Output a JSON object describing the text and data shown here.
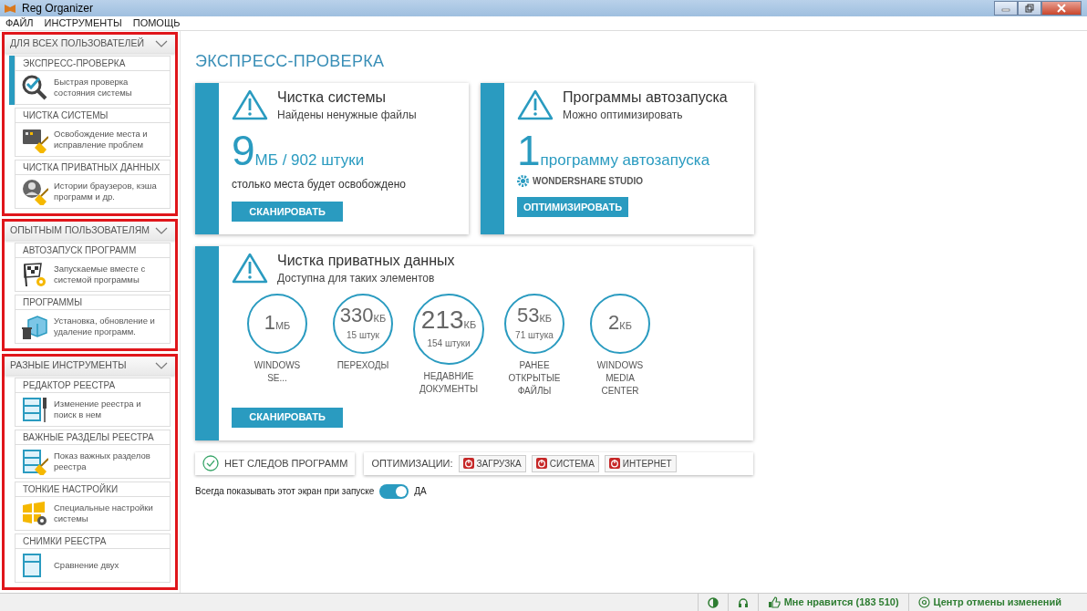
{
  "window": {
    "title": "Reg Organizer"
  },
  "menu": [
    "ФАЙЛ",
    "ИНСТРУМЕНТЫ",
    "ПОМОЩЬ"
  ],
  "sidebar": {
    "groups": [
      {
        "title": "ДЛЯ ВСЕХ ПОЛЬЗОВАТЕЛЕЙ",
        "expanded": true,
        "highlighted": true,
        "items": [
          {
            "title": "ЭКСПРЕСС-ПРОВЕРКА",
            "description": "Быстрая проверка состояния системы",
            "selected": true
          },
          {
            "title": "ЧИСТКА СИСТЕМЫ",
            "description": "Освобождение места и исправление проблем",
            "selected": false
          },
          {
            "title": "ЧИСТКА ПРИВАТНЫХ ДАННЫХ",
            "description": "Истории браузеров, кэша программ и др.",
            "selected": false
          }
        ]
      },
      {
        "title": "ОПЫТНЫМ ПОЛЬЗОВАТЕЛЯМ",
        "expanded": true,
        "highlighted": true,
        "items": [
          {
            "title": "АВТОЗАПУСК ПРОГРАММ",
            "description": "Запускаемые вместе с системой программы",
            "selected": false
          },
          {
            "title": "ПРОГРАММЫ",
            "description": "Установка, обновление и удаление программ.",
            "selected": false
          }
        ]
      },
      {
        "title": "РАЗНЫЕ ИНСТРУМЕНТЫ",
        "expanded": true,
        "highlighted": true,
        "items": [
          {
            "title": "РЕДАКТОР РЕЕСТРА",
            "description": "Изменение реестра и поиск в нем",
            "selected": false
          },
          {
            "title": "ВАЖНЫЕ РАЗДЕЛЫ РЕЕСТРА",
            "description": "Показ важных разделов реестра",
            "selected": false
          },
          {
            "title": "ТОНКИЕ НАСТРОЙКИ",
            "description": "Специальные настройки системы",
            "selected": false
          },
          {
            "title": "СНИМКИ РЕЕСТРА",
            "description": "Сравнение двух",
            "selected": false
          }
        ]
      }
    ]
  },
  "page_title": "ЭКСПРЕСС-ПРОВЕРКА",
  "cards": [
    {
      "kind": "summary",
      "title": "Чистка системы",
      "subtitle": "Найдены ненужные файлы",
      "value": "9",
      "unit": "МБ / 902 штуки",
      "caption": "столько места будет освобождено",
      "button": "СКАНИРОВАТЬ"
    },
    {
      "kind": "summary",
      "title": "Программы автозапуска",
      "subtitle": "Можно оптимизировать",
      "value": "1",
      "unit": "программу автозапуска",
      "program": "WONDERSHARE STUDIO",
      "button": "ОПТИМИЗИРОВАТЬ"
    },
    {
      "kind": "privacy",
      "title": "Чистка приватных данных",
      "subtitle": "Доступна для таких элементов",
      "stats": [
        {
          "value": "1",
          "unit": "МБ",
          "label": "WINDOWS SE..."
        },
        {
          "value": "330",
          "unit": "КБ",
          "count": "15 штук",
          "label": "ПЕРЕХОДЫ"
        },
        {
          "value": "213",
          "unit": "КБ",
          "count": "154 штуки",
          "label": "НЕДАВНИЕ ДОКУМЕНТЫ"
        },
        {
          "value": "53",
          "unit": "КБ",
          "count": "71 штука",
          "label": "РАНЕЕ ОТКРЫТЫЕ ФАЙЛЫ"
        },
        {
          "value": "2",
          "unit": "КБ",
          "label": "WINDOWS MEDIA CENTER"
        }
      ],
      "button": "СКАНИРОВАТЬ"
    }
  ],
  "traces": {
    "label": "НЕТ СЛЕДОВ ПРОГРАММ"
  },
  "optimizations": {
    "label": "ОПТИМИЗАЦИИ:",
    "items": [
      "ЗАГРУЗКА",
      "СИСТЕМА",
      "ИНТЕРНЕТ"
    ]
  },
  "startup_toggle": {
    "label": "Всегда показывать этот экран при запуске",
    "on": true,
    "value": "ДА"
  },
  "status_bar": {
    "like": "Мне нравится (183 510)",
    "undo": "Центр отмены изменений"
  }
}
